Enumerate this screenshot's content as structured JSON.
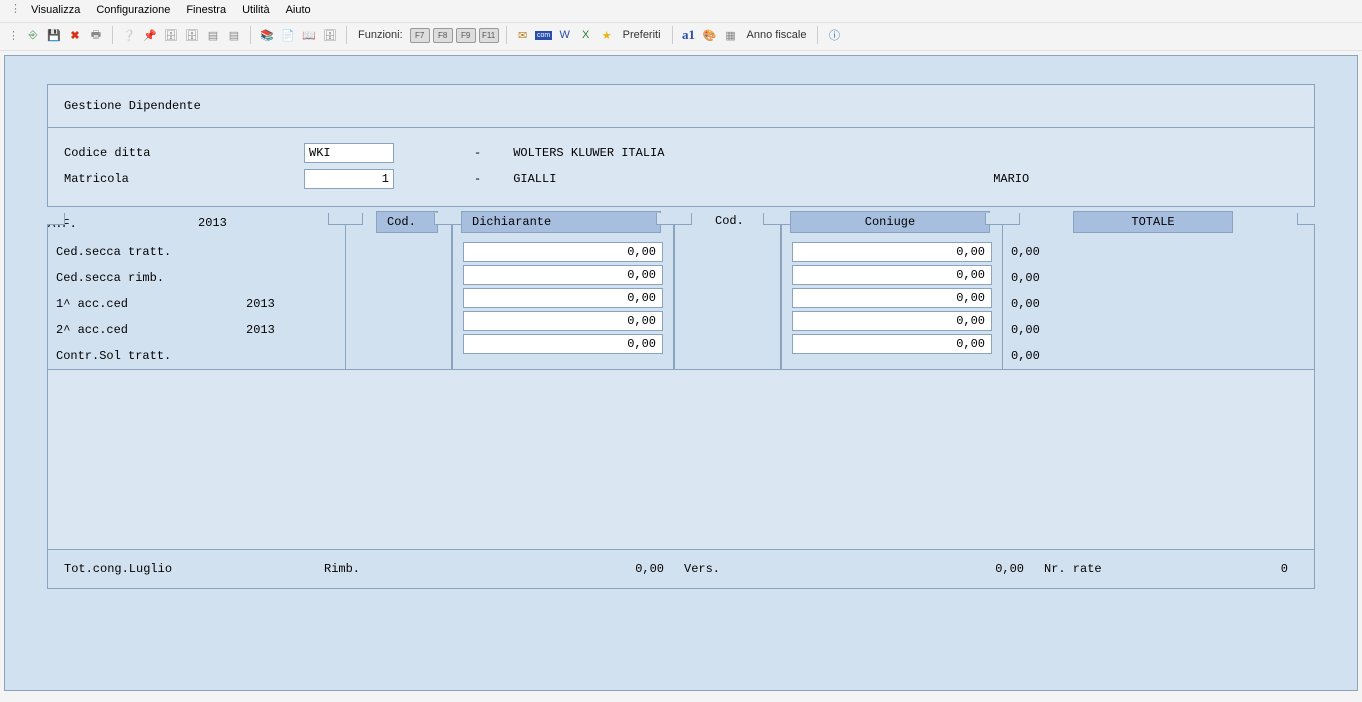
{
  "menu": {
    "visualizza": "Visualizza",
    "configurazione": "Configurazione",
    "finestra": "Finestra",
    "utilita": "Utilità",
    "aiuto": "Aiuto"
  },
  "toolbar": {
    "funzioni": "Funzioni:",
    "f7": "F7",
    "f8": "F8",
    "f9": "F9",
    "f11": "F11",
    "preferiti": "Preferiti",
    "anno_fiscale": "Anno fiscale",
    "a1": "a1"
  },
  "panel": {
    "title": "Gestione Dipendente",
    "codice_ditta_label": "Codice ditta",
    "codice_ditta_value": "WKI",
    "codice_ditta_desc": "WOLTERS KLUWER ITALIA",
    "matricola_label": "Matricola",
    "matricola_value": "1",
    "matricola_lastname": "GIALLI",
    "matricola_firstname": "MARIO",
    "dash": "-"
  },
  "grid": {
    "af_label": "A.F.",
    "af_year": "2013",
    "cod_label": "Cod.",
    "dichiarante_label": "Dichiarante",
    "coniuge_label": "Coniuge",
    "totale_label": "TOTALE",
    "rows": [
      {
        "label": "Ced.secca tratt.",
        "year": "",
        "dich": "0,00",
        "con": "0,00",
        "tot": "0,00"
      },
      {
        "label": "Ced.secca rimb.",
        "year": "",
        "dich": "0,00",
        "con": "0,00",
        "tot": "0,00"
      },
      {
        "label": "1^ acc.ced",
        "year": "2013",
        "dich": "0,00",
        "con": "0,00",
        "tot": "0,00"
      },
      {
        "label": "2^ acc.ced",
        "year": "2013",
        "dich": "0,00",
        "con": "0,00",
        "tot": "0,00"
      },
      {
        "label": "Contr.Sol tratt.",
        "year": "",
        "dich": "0,00",
        "con": "0,00",
        "tot": "0,00"
      }
    ]
  },
  "footer": {
    "tot_cong_label": "Tot.cong.Luglio",
    "rimb_label": "Rimb.",
    "rimb_value": "0,00",
    "vers_label": "Vers.",
    "vers_value": "0,00",
    "nr_rate_label": "Nr. rate",
    "nr_rate_value": "0"
  }
}
